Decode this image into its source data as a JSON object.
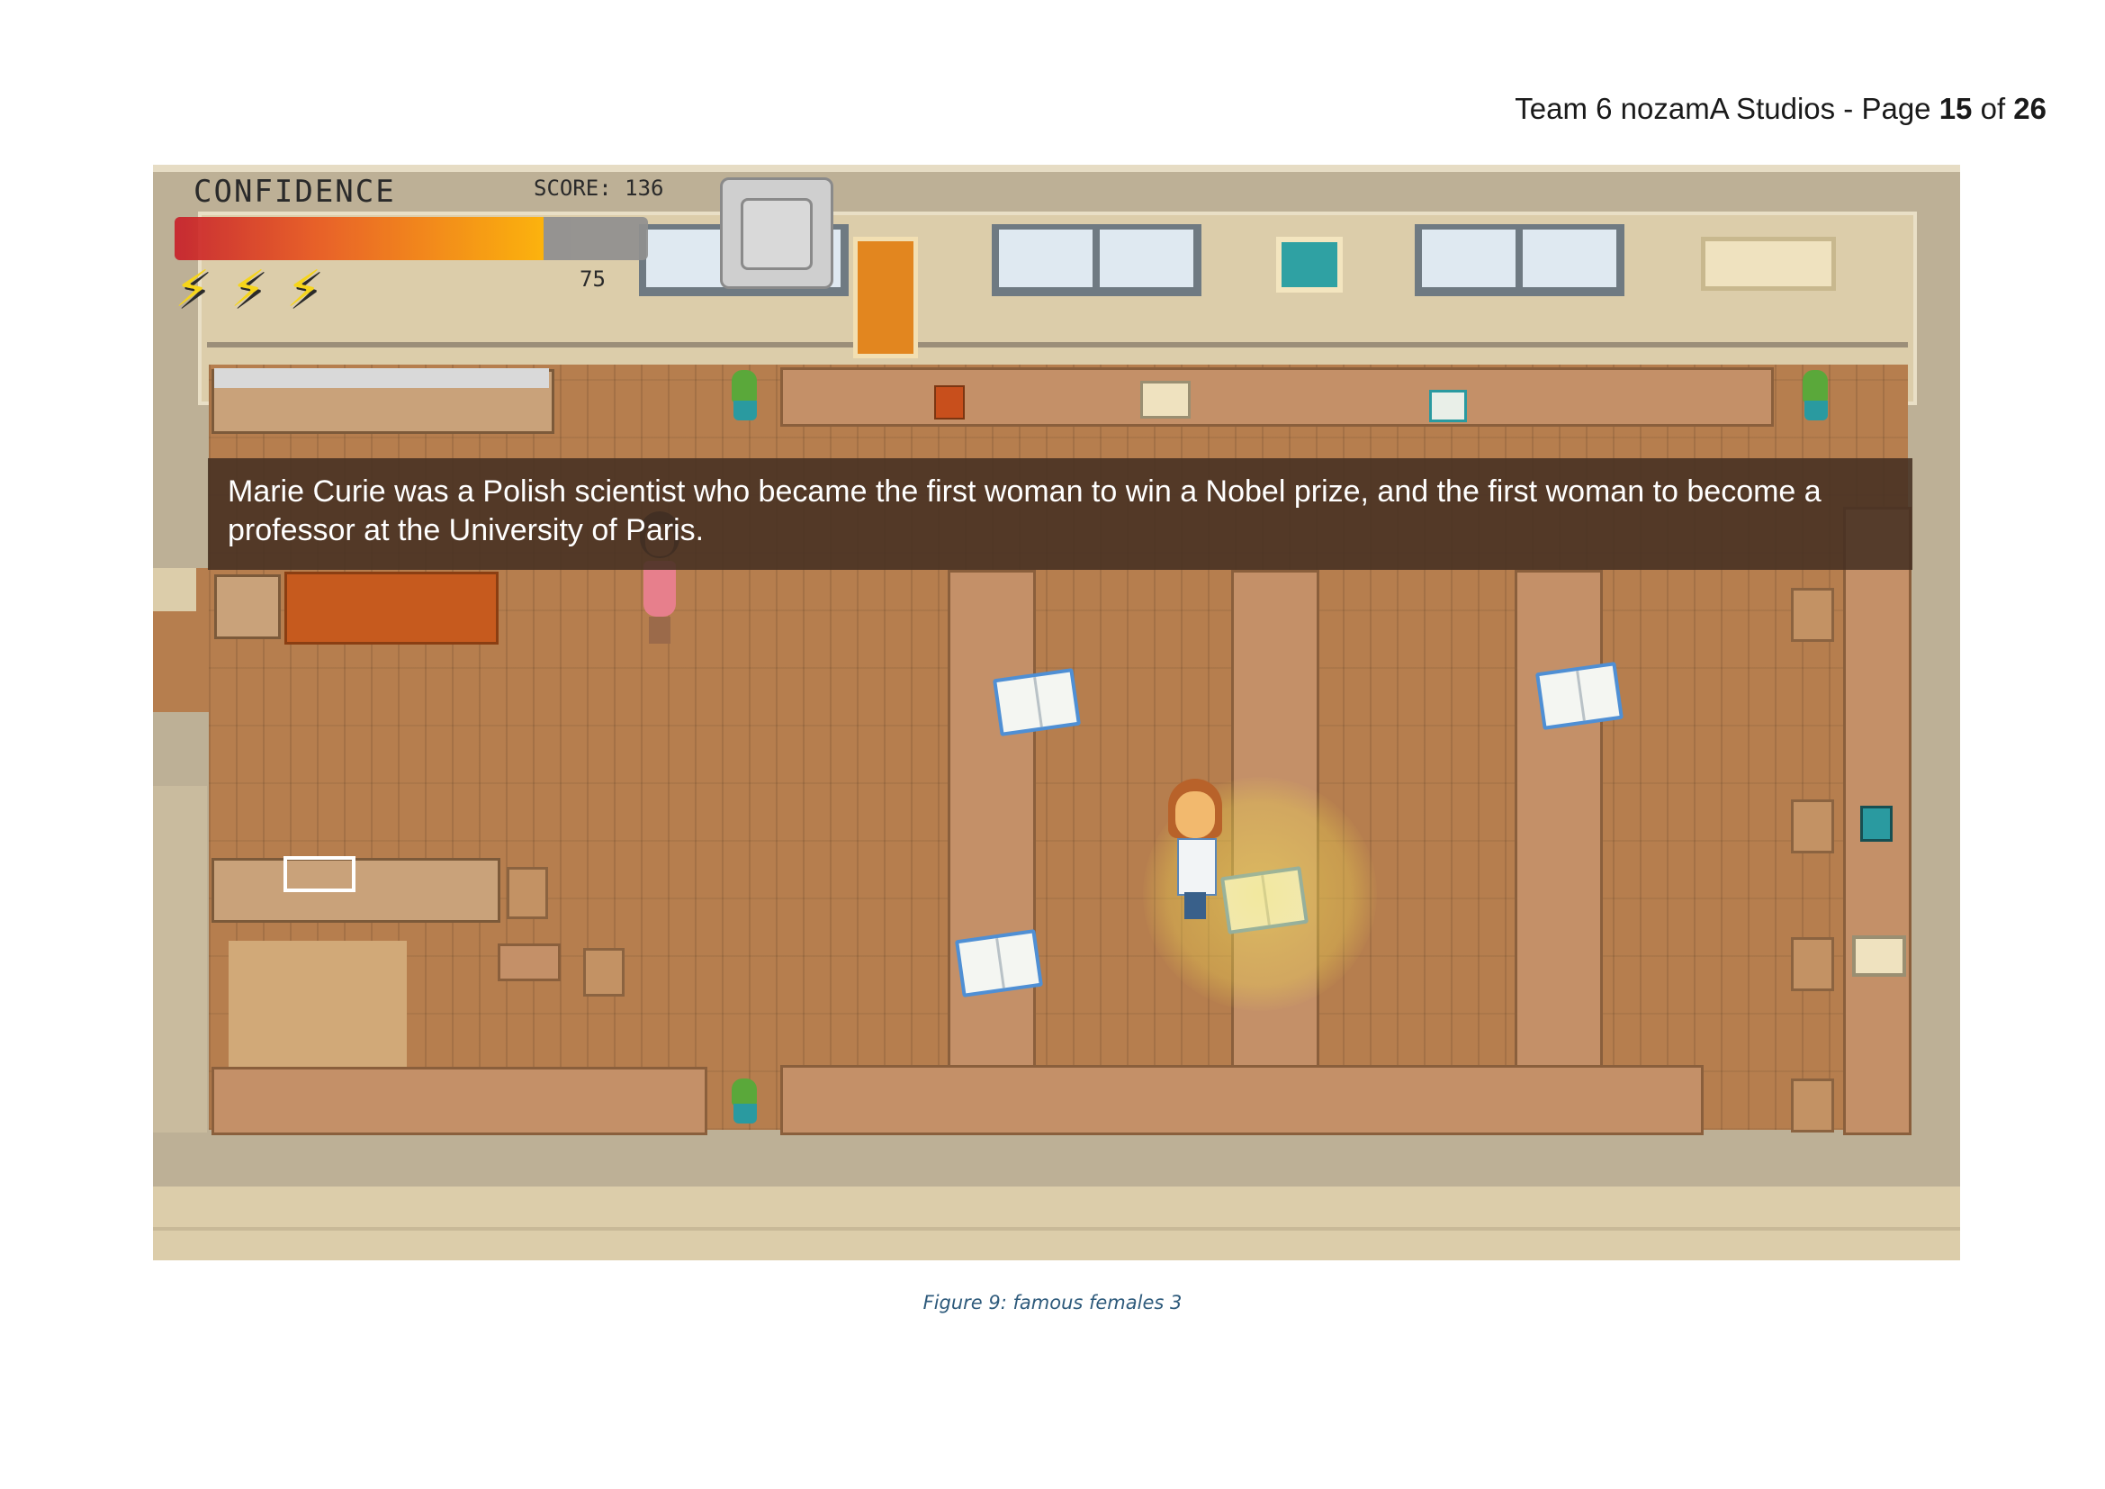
{
  "page_header": {
    "prefix": "Team 6 nozamA Studios - Page ",
    "page": "15",
    "of": " of ",
    "total": "26"
  },
  "hud": {
    "confidence_label": "CONFIDENCE",
    "confidence_level": 0.78,
    "score_label": "SCORE: 136",
    "secondary_value": "75",
    "lightning_count": 3,
    "pause_button_icon": "pause-button-icon"
  },
  "dialog": {
    "text": "Marie Curie was a Polish scientist who became the first woman to win a Nobel prize, and the first woman to become a professor at the University of Paris."
  },
  "figure": {
    "caption": "Figure 9: famous females 3"
  },
  "colors": {
    "floor": "#b67e4e",
    "wall": "#dccdaa",
    "dialog_bg": "#463022",
    "bar_start": "#c8202a",
    "bar_end": "#ffb100",
    "book_border": "#4f8fd4",
    "caption": "#2f5b7c"
  }
}
